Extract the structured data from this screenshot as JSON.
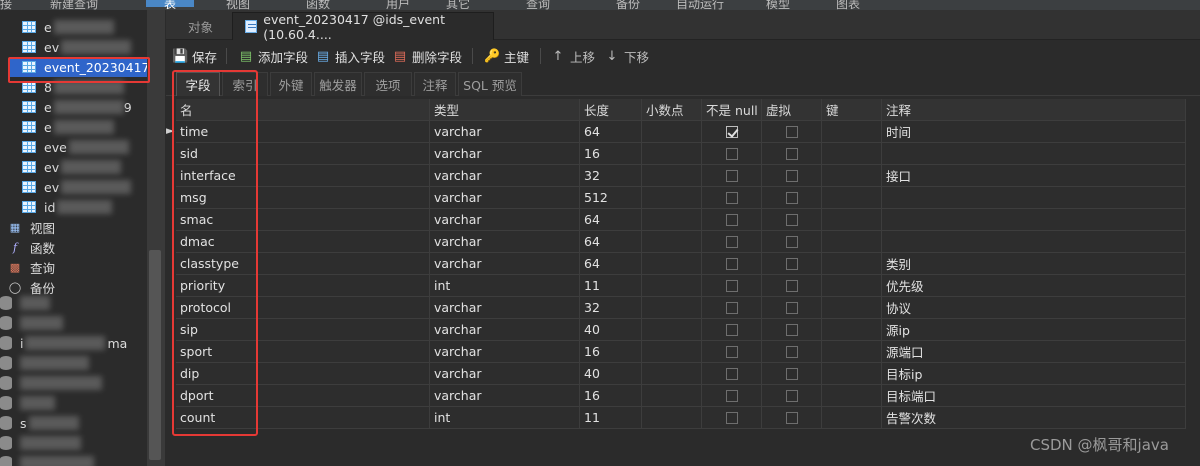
{
  "topmenu": [
    "接",
    "新建查询",
    "表",
    "视图",
    "函数",
    "用户",
    "其它",
    "查询",
    "备份",
    "自动运行",
    "模型",
    "图表"
  ],
  "sidebar": {
    "tables": [
      {
        "label": "e",
        "blurred": true
      },
      {
        "label": "ev",
        "blurred": true
      },
      {
        "label": "event_20230417",
        "selected": true
      },
      {
        "label": "8",
        "blurred": true,
        "suffix": true
      },
      {
        "label": "e",
        "blurred": true,
        "tail": "9"
      },
      {
        "label": "e",
        "blurred": true
      },
      {
        "label": "eve",
        "blurred": true
      },
      {
        "label": "ev",
        "blurred": true
      },
      {
        "label": "ev",
        "blurred": true
      },
      {
        "label": "id",
        "blurred": true
      }
    ],
    "objects": [
      {
        "label": "视图",
        "icon": "view-icon"
      },
      {
        "label": "函数",
        "icon": "function-icon"
      },
      {
        "label": "查询",
        "icon": "query-icon"
      },
      {
        "label": "备份",
        "icon": "backup-icon"
      }
    ],
    "databases_partial": [
      "i",
      "ma",
      "s"
    ]
  },
  "tabs": [
    {
      "label": "对象",
      "active": false
    },
    {
      "label": "event_20230417 @ids_event (10.60.4....",
      "active": true
    }
  ],
  "toolbar": {
    "save": "保存",
    "add_field": "添加字段",
    "insert_field": "插入字段",
    "delete_field": "删除字段",
    "primary_key": "主键",
    "move_up": "上移",
    "move_down": "下移"
  },
  "subtabs": [
    "字段",
    "索引",
    "外键",
    "触发器",
    "选项",
    "注释",
    "SQL 预览"
  ],
  "grid": {
    "columns": [
      "名",
      "类型",
      "长度",
      "小数点",
      "不是 null",
      "虚拟",
      "键",
      "注释"
    ],
    "rows": [
      {
        "name": "time",
        "type": "varchar",
        "length": "64",
        "decimals": "",
        "not_null": true,
        "virtual": false,
        "key": "",
        "comment": "时间"
      },
      {
        "name": "sid",
        "type": "varchar",
        "length": "16",
        "decimals": "",
        "not_null": false,
        "virtual": false,
        "key": "",
        "comment": ""
      },
      {
        "name": "interface",
        "type": "varchar",
        "length": "32",
        "decimals": "",
        "not_null": false,
        "virtual": false,
        "key": "",
        "comment": "接口"
      },
      {
        "name": "msg",
        "type": "varchar",
        "length": "512",
        "decimals": "",
        "not_null": false,
        "virtual": false,
        "key": "",
        "comment": ""
      },
      {
        "name": "smac",
        "type": "varchar",
        "length": "64",
        "decimals": "",
        "not_null": false,
        "virtual": false,
        "key": "",
        "comment": ""
      },
      {
        "name": "dmac",
        "type": "varchar",
        "length": "64",
        "decimals": "",
        "not_null": false,
        "virtual": false,
        "key": "",
        "comment": ""
      },
      {
        "name": "classtype",
        "type": "varchar",
        "length": "64",
        "decimals": "",
        "not_null": false,
        "virtual": false,
        "key": "",
        "comment": "类别"
      },
      {
        "name": "priority",
        "type": "int",
        "length": "11",
        "decimals": "",
        "not_null": false,
        "virtual": false,
        "key": "",
        "comment": "优先级"
      },
      {
        "name": "protocol",
        "type": "varchar",
        "length": "32",
        "decimals": "",
        "not_null": false,
        "virtual": false,
        "key": "",
        "comment": "协议"
      },
      {
        "name": "sip",
        "type": "varchar",
        "length": "40",
        "decimals": "",
        "not_null": false,
        "virtual": false,
        "key": "",
        "comment": "源ip"
      },
      {
        "name": "sport",
        "type": "varchar",
        "length": "16",
        "decimals": "",
        "not_null": false,
        "virtual": false,
        "key": "",
        "comment": "源端口"
      },
      {
        "name": "dip",
        "type": "varchar",
        "length": "40",
        "decimals": "",
        "not_null": false,
        "virtual": false,
        "key": "",
        "comment": "目标ip"
      },
      {
        "name": "dport",
        "type": "varchar",
        "length": "16",
        "decimals": "",
        "not_null": false,
        "virtual": false,
        "key": "",
        "comment": "目标端口"
      },
      {
        "name": "count",
        "type": "int",
        "length": "11",
        "decimals": "",
        "not_null": false,
        "virtual": false,
        "key": "",
        "comment": "告警次数"
      }
    ]
  },
  "watermark": "CSDN @枫哥和java",
  "colors": {
    "highlight": "#e53935",
    "selection": "#2f65ca",
    "table_icon": "#5aa9e6"
  }
}
